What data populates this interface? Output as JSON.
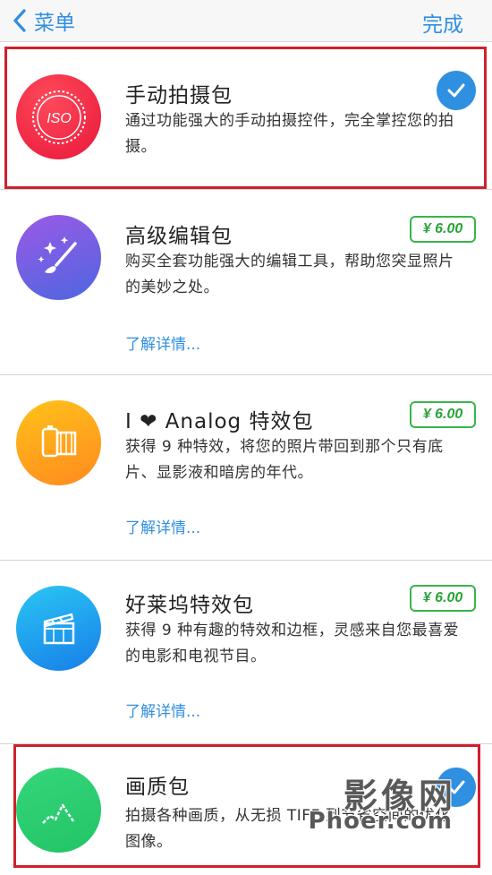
{
  "nav": {
    "back_label": "菜单",
    "done_label": "完成"
  },
  "items": [
    {
      "title": "手动拍摄包",
      "desc": "通过功能强大的手动拍摄控件，完全掌控您的拍摄。",
      "status": "purchased",
      "icon": "iso-icon",
      "icon_text": "ISO",
      "color": "#f0254a"
    },
    {
      "title": "高级编辑包",
      "desc": "购买全套功能强大的编辑工具，帮助您突显照片的美妙之处。",
      "price": "¥ 6.00",
      "more": "了解详情...",
      "icon": "paintbrush-sparkle-icon",
      "color": "#7b5cd8"
    },
    {
      "title": "I ❤ Analog 特效包",
      "desc": "获得 9 种特效，将您的照片带回到那个只有底片、显影液和暗房的年代。",
      "price": "¥ 6.00",
      "more": "了解详情...",
      "icon": "film-roll-icon",
      "color": "#ffa21c"
    },
    {
      "title": "好莱坞特效包",
      "desc": "获得 9 种有趣的特效和边框，灵感来自您最喜爱的电影和电视节目。",
      "price": "¥ 6.00",
      "more": "了解详情...",
      "icon": "clapperboard-icon",
      "color": "#1ea6ee"
    },
    {
      "title": "画质包",
      "desc": "拍摄各种画质，从无损 TIFF 到节省空间的优化图像。",
      "status": "purchased",
      "icon": "quality-chart-icon",
      "color": "#2ecf6f"
    }
  ],
  "watermark": {
    "line1": "影像网",
    "line2": "Phoer.com"
  }
}
